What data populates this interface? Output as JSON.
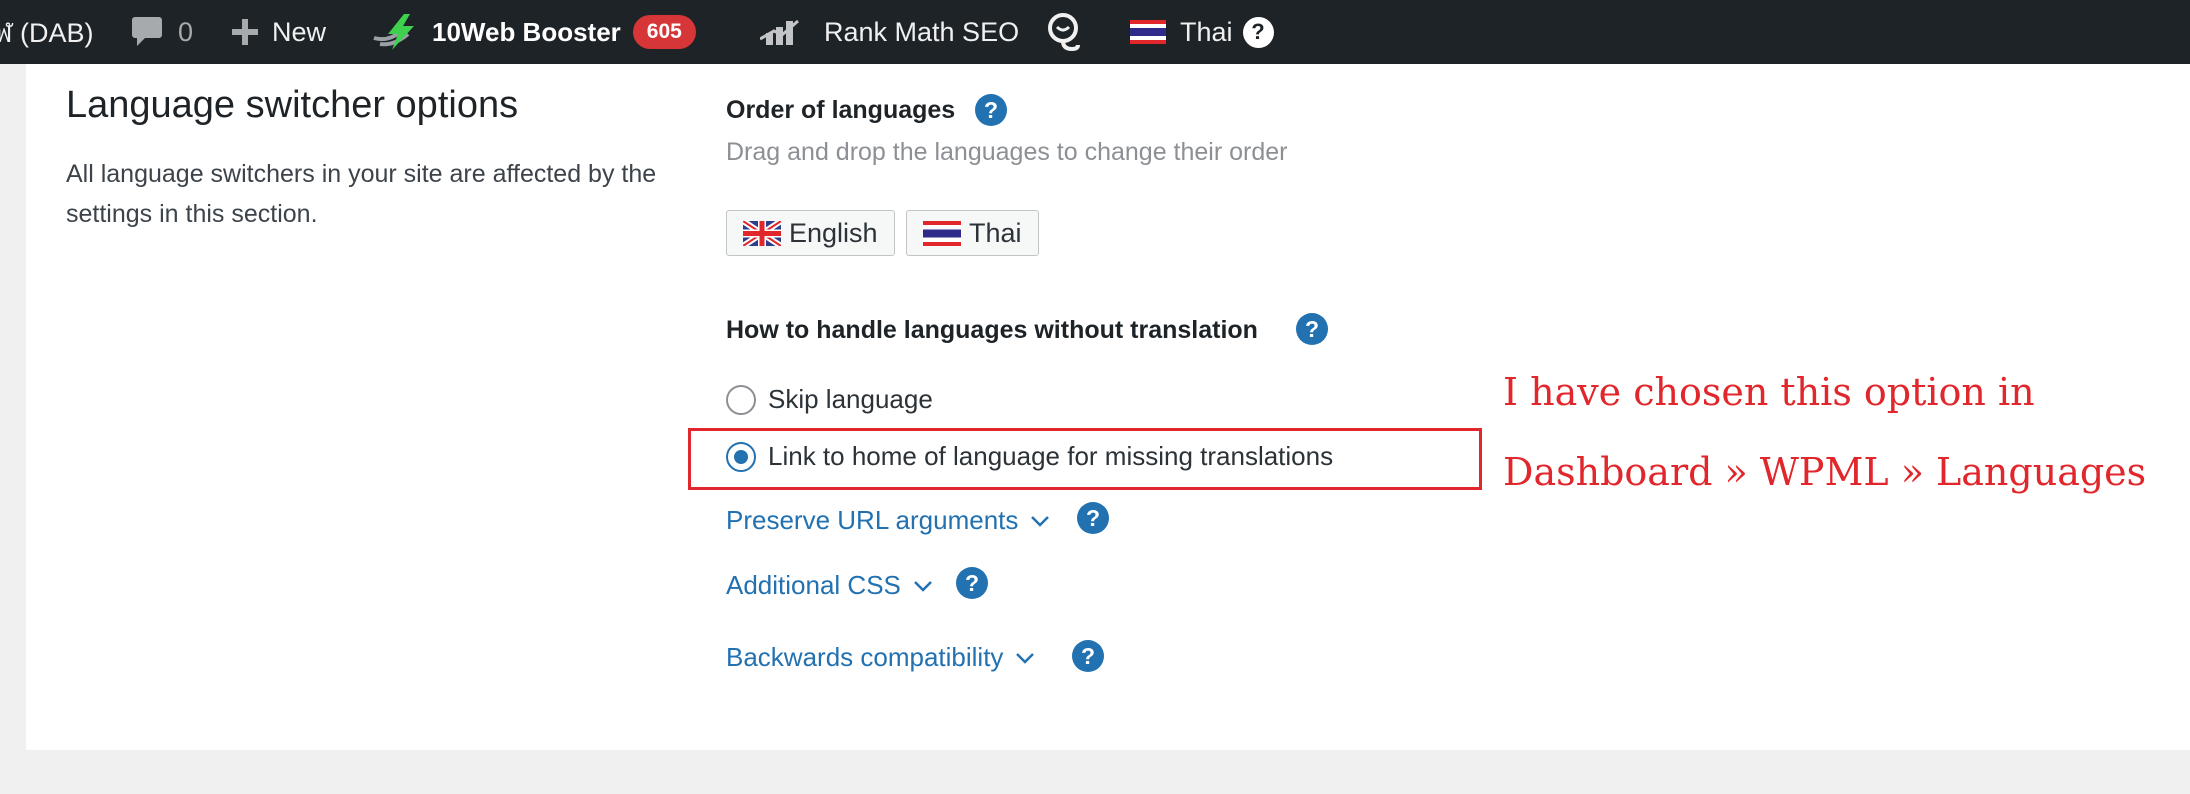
{
  "adminbar": {
    "site_name": "ฬ (DAB)",
    "comments_count": "0",
    "new_label": "New",
    "booster_label": "10Web Booster",
    "booster_badge": "605",
    "rankmath_label": "Rank Math SEO",
    "language_label": "Thai",
    "help_glyph": "?"
  },
  "section": {
    "title": "Language switcher options",
    "description": "All language switchers in your site are affected by the settings in this section."
  },
  "order": {
    "label": "Order of languages",
    "hint": "Drag and drop the languages to change their order",
    "languages": [
      "English",
      "Thai"
    ]
  },
  "missing": {
    "label": "How to handle languages without translation",
    "options": [
      {
        "label": "Skip language",
        "checked": false
      },
      {
        "label": "Link to home of language for missing translations",
        "checked": true
      }
    ]
  },
  "toggles": [
    "Preserve URL arguments",
    "Additional CSS",
    "Backwards compatibility"
  ],
  "annotation": {
    "line1": "I have chosen this option in",
    "line2": "Dashboard » WPML » Languages"
  },
  "colors": {
    "adminbar_bg": "#1d2327",
    "link_blue": "#2271b1",
    "badge_red": "#d63638",
    "annotation_red": "#e1262c"
  },
  "icons": [
    "comment-icon",
    "plus-icon",
    "bolt-icon",
    "rankmath-icon",
    "wpml-logo-icon",
    "thai-flag-icon",
    "uk-flag-icon",
    "help-icon",
    "chevron-down-icon"
  ]
}
